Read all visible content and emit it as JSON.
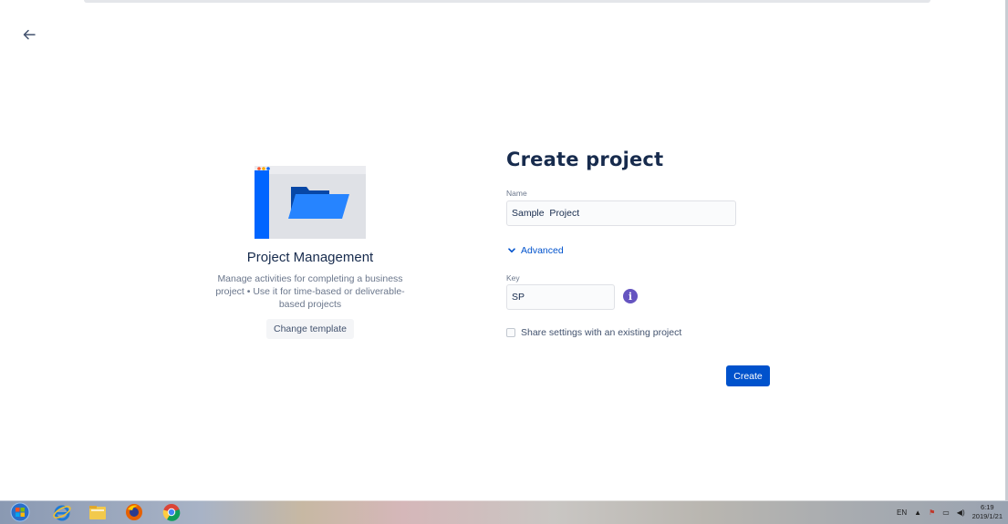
{
  "app": {
    "back_icon": "arrow-left-icon"
  },
  "template": {
    "title": "Project Management",
    "description_lines": [
      "Manage activities for completing a business",
      "project • Use it for time-based or deliverable-",
      "based projects"
    ],
    "change_button": "Change template",
    "colors": {
      "folder": "#0065ff",
      "sidebar": "#0052cc",
      "window": "#dfe1e6"
    }
  },
  "form": {
    "title": "Create project",
    "name_label": "Name",
    "name_value": "Sample  Project",
    "advanced_label": "Advanced",
    "key_label": "Key",
    "key_value": "SP",
    "share_label": "Share settings with an existing project",
    "share_checked": false,
    "create_button": "Create"
  },
  "taskbar": {
    "apps": [
      "windows-start-icon",
      "internet-explorer-icon",
      "file-explorer-icon",
      "firefox-icon",
      "chrome-icon"
    ],
    "language": "EN",
    "time": "6:19",
    "date": "2019/1/21"
  },
  "colors": {
    "primary": "#0052cc",
    "text": "#172b4d",
    "subtle_text": "#6b778c",
    "info": "#6554c0"
  }
}
